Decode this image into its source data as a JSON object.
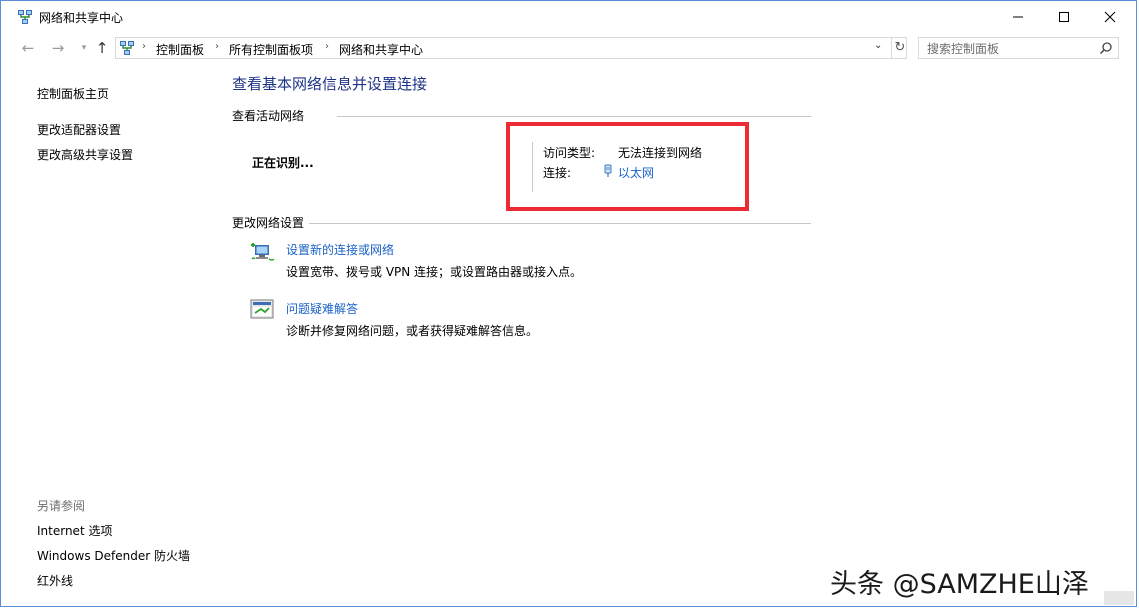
{
  "window": {
    "title": "网络和共享中心"
  },
  "address": {
    "crumbs": [
      "控制面板",
      "所有控制面板项",
      "网络和共享中心"
    ]
  },
  "search": {
    "placeholder": "搜索控制面板"
  },
  "sidebar": {
    "home_link": "控制面板主页",
    "links": [
      "更改适配器设置",
      "更改高级共享设置"
    ],
    "see_also_heading": "另请参阅",
    "see_also": [
      "Internet 选项",
      "Windows Defender 防火墙",
      "红外线"
    ]
  },
  "main": {
    "title": "查看基本网络信息并设置连接",
    "active_networks": {
      "heading": "查看活动网络",
      "status": "正在识别...",
      "access_type_label": "访问类型:",
      "access_type_value": "无法连接到网络",
      "connection_label": "连接:",
      "connection_value": "以太网"
    },
    "change_settings": {
      "heading": "更改网络设置",
      "tasks": [
        {
          "title": "设置新的连接或网络",
          "desc": "设置宽带、拨号或 VPN 连接；或设置路由器或接入点。",
          "icon": "new-connection-icon"
        },
        {
          "title": "问题疑难解答",
          "desc": "诊断并修复网络问题，或者获得疑难解答信息。",
          "icon": "troubleshoot-icon"
        }
      ]
    }
  },
  "watermark": "头条 @SAMZHE山泽",
  "colors": {
    "title_blue": "#1e3287",
    "link_blue": "#1a62c7",
    "highlight_red": "#ed2b35"
  }
}
